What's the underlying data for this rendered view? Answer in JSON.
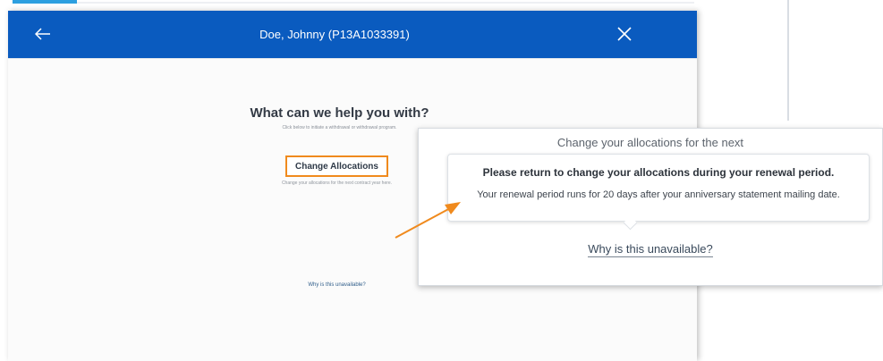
{
  "header": {
    "title": "Doe, Johnny (P13A1033391)",
    "back_icon": "arrow-left-icon",
    "close_icon": "close-icon"
  },
  "main": {
    "heading": "What can we help you with?",
    "subheading": "Click below to initiate a withdrawal or withdrawal program.",
    "change_button_label": "Change Allocations",
    "change_caption": "Change your allocations for the next contract year here.",
    "why_link": "Why is this unavailable?"
  },
  "callout": {
    "top_text": "Change your allocations for the next",
    "tooltip_title": "Please return to change your allocations during your renewal period.",
    "tooltip_body": "Your renewal period runs for 20 days after your anniversary statement mailing date.",
    "why_link": "Why is this unavailable?"
  },
  "colors": {
    "header_bg": "#0a5bbf",
    "highlight": "#f08a1d",
    "accent": "#2c9fe0"
  }
}
